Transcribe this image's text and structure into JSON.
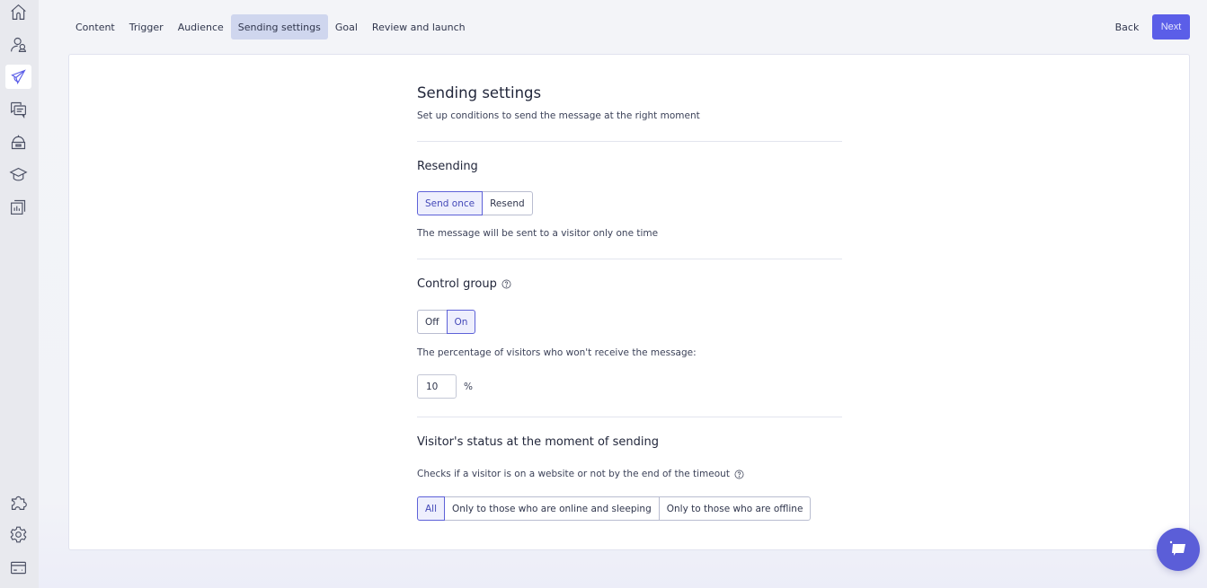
{
  "sidebar": {
    "top_items": [
      {
        "name": "home",
        "icon": "home-icon"
      },
      {
        "name": "contacts",
        "icon": "users-icon"
      },
      {
        "name": "campaigns",
        "icon": "paper-plane-icon",
        "active": true
      },
      {
        "name": "conversations",
        "icon": "chat-icon"
      },
      {
        "name": "bots",
        "icon": "robot-icon"
      },
      {
        "name": "academy",
        "icon": "graduation-cap-icon"
      },
      {
        "name": "reports",
        "icon": "bar-chart-icon"
      }
    ],
    "bottom_items": [
      {
        "name": "integrations",
        "icon": "puzzle-icon"
      },
      {
        "name": "settings",
        "icon": "gear-icon"
      },
      {
        "name": "billing",
        "icon": "credit-card-icon"
      }
    ]
  },
  "topnav": {
    "tabs": [
      {
        "label": "Content"
      },
      {
        "label": "Trigger"
      },
      {
        "label": "Audience"
      },
      {
        "label": "Sending settings",
        "active": true
      },
      {
        "label": "Goal"
      },
      {
        "label": "Review and launch"
      }
    ],
    "back_label": "Back",
    "next_label": "Next"
  },
  "page": {
    "title": "Sending settings",
    "subtitle": "Set up conditions to send the message at the right moment",
    "resending": {
      "heading": "Resending",
      "options": [
        "Send once",
        "Resend"
      ],
      "selected": "Send once",
      "description": "The message will be sent to a visitor only one time"
    },
    "control_group": {
      "heading": "Control group",
      "options": [
        "Off",
        "On"
      ],
      "selected": "On",
      "percentage_label": "The percentage of visitors who won't receive the message:",
      "percentage_value": "10",
      "percentage_unit": "%"
    },
    "visitor_status": {
      "heading": "Visitor's status at the moment of sending",
      "description": "Checks if a visitor is on a website or not by the end of the timeout",
      "options": [
        "All",
        "Only to those who are online and sleeping",
        "Only to those who are offline"
      ],
      "selected": "All"
    }
  },
  "colors": {
    "accent": "#5b5ee8",
    "active_tab_bg": "#cfd6ee",
    "segment_active_border": "#5d61d8",
    "segment_active_bg": "#eeeffd"
  }
}
